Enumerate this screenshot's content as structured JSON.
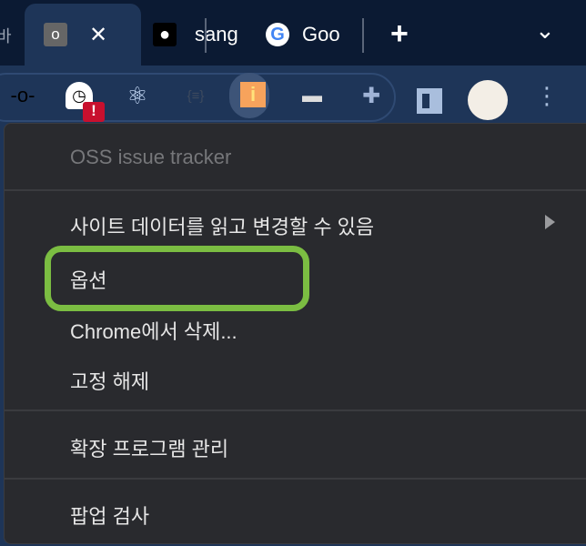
{
  "tabs": [
    {
      "label": "o",
      "favicon_text": "o",
      "close": "✕",
      "favicon": "letter-o-icon"
    },
    {
      "label": "sang",
      "favicon": "github-icon"
    },
    {
      "label": "Goo",
      "favicon": "google-icon"
    }
  ],
  "tabstrip": {
    "new_tab": "+",
    "tab_search": "⌄",
    "left_partial": "바"
  },
  "toolbar": {
    "badge": "!"
  },
  "menu": {
    "title": "OSS issue tracker",
    "items": [
      {
        "label": "사이트 데이터를 읽고 변경할 수 있음"
      },
      {
        "label": "옵션"
      },
      {
        "label": "Chrome에서 삭제..."
      },
      {
        "label": "고정 해제"
      },
      {
        "label": "확장 프로그램 관리"
      },
      {
        "label": "팝업 검사"
      }
    ]
  },
  "colors": {
    "highlight": "#7bbd42",
    "menu_bg": "#292a2e",
    "toolbar_bg": "#1e3558"
  }
}
